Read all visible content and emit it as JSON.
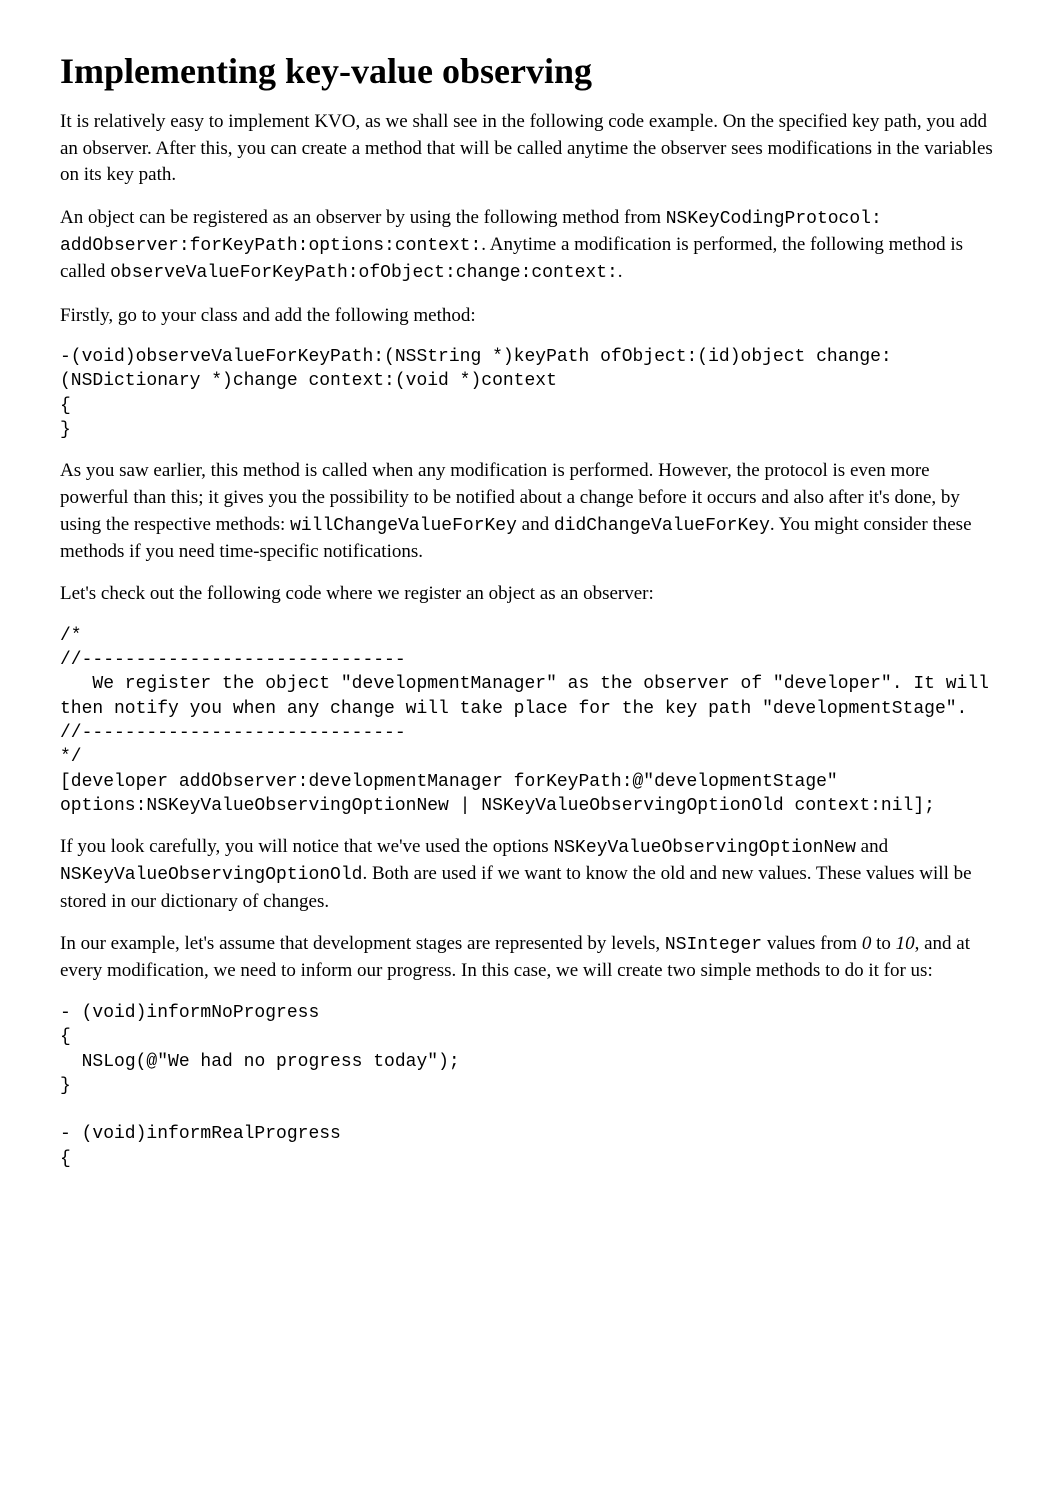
{
  "title": "Implementing key-value observing",
  "p1": "It is relatively easy to implement KVO, as we shall see in the following code example. On the specified key path, you add an observer. After this, you can create a method that will be called anytime the observer sees modifications in the variables on its key path.",
  "p2_a": "An object can be registered as an observer by using the following method from ",
  "p2_code1": "NSKeyCodingProtocol: addObserver:forKeyPath:options:context:",
  "p2_b": ". Anytime a modification is performed, the following method is called ",
  "p2_code2": "observeValueForKeyPath:ofObject:change:context:",
  "p2_c": ".",
  "p3": "Firstly, go to your class and add the following method:",
  "code1": "-(void)observeValueForKeyPath:(NSString *)keyPath ofObject:(id)object change:(NSDictionary *)change context:(void *)context\n{\n}",
  "p4_a": "As you saw earlier, this method is called when any modification is performed. However, the protocol is even more powerful than this; it gives you the possibility to be notified about a change before it occurs and also after it's done, by using the respective methods: ",
  "p4_code1": "willChangeValueForKey",
  "p4_b": " and ",
  "p4_code2": "didChangeValueForKey",
  "p4_c": ". You might consider these methods if you need time-specific notifications.",
  "p5": "Let's check out the following code where we register an object as an observer:",
  "code2": "/*\n//------------------------------\n   We register the object \"developmentManager\" as the observer of \"developer\". It will then notify you when any change will take place for the key path \"developmentStage\".\n//------------------------------\n*/\n[developer addObserver:developmentManager forKeyPath:@\"developmentStage\" options:NSKeyValueObservingOptionNew | NSKeyValueObservingOptionOld context:nil];",
  "p6_a": "If you look carefully, you will notice that we've used the options ",
  "p6_code1": "NSKeyValueObservingOptionNew",
  "p6_b": " and ",
  "p6_code2": "NSKeyValueObservingOptionOld",
  "p6_c": ". Both are used if we want to know the old and new values. These values will be stored in our dictionary of changes.",
  "p7_a": "In our example, let's assume that development stages are represented by levels, ",
  "p7_code1": "NSInteger",
  "p7_b": " values from ",
  "p7_i1": "0",
  "p7_c": " to ",
  "p7_i2": "10",
  "p7_d": ", and at every modification, we need to inform our progress. In this case, we will create two simple methods to do it for us:",
  "code3": "- (void)informNoProgress\n{\n  NSLog(@\"We had no progress today\");\n}\n\n- (void)informRealProgress\n{"
}
